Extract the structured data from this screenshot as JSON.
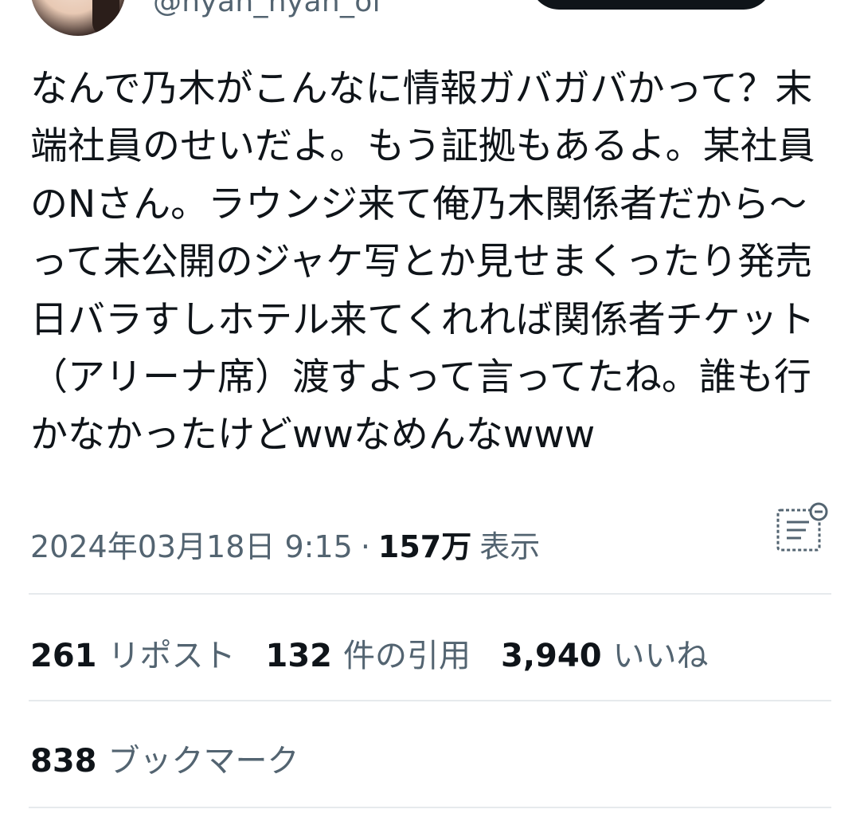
{
  "author": {
    "handle": "@nyan_nyan_ol"
  },
  "tweet": {
    "text": "なんで乃木がこんなに情報ガバガバかって？末端社員のせいだよ。もう証拠もあるよ。某社員のNさん。ラウンジ来て俺乃木関係者だから〜って未公開のジャケ写とか見せまくったり発売日バラすしホテル来てくれれば関係者チケット（アリーナ席）渡すよって言ってたね。誰も行かなかったけどwwなめんなwww",
    "timestamp": "2024年03月18日 9:15",
    "separator": "·",
    "views_count": "157万",
    "views_label": "表示"
  },
  "icons": {
    "translate": "translate-icon",
    "avatar": "avatar"
  },
  "stats": {
    "reposts_count": "261",
    "reposts_label": "リポスト",
    "quotes_count": "132",
    "quotes_label": "件の引用",
    "likes_count": "3,940",
    "likes_label": "いいね",
    "bookmarks_count": "838",
    "bookmarks_label": "ブックマーク"
  },
  "colors": {
    "text_primary": "#0f1419",
    "text_secondary": "#536471",
    "divider": "#e6eaed"
  }
}
